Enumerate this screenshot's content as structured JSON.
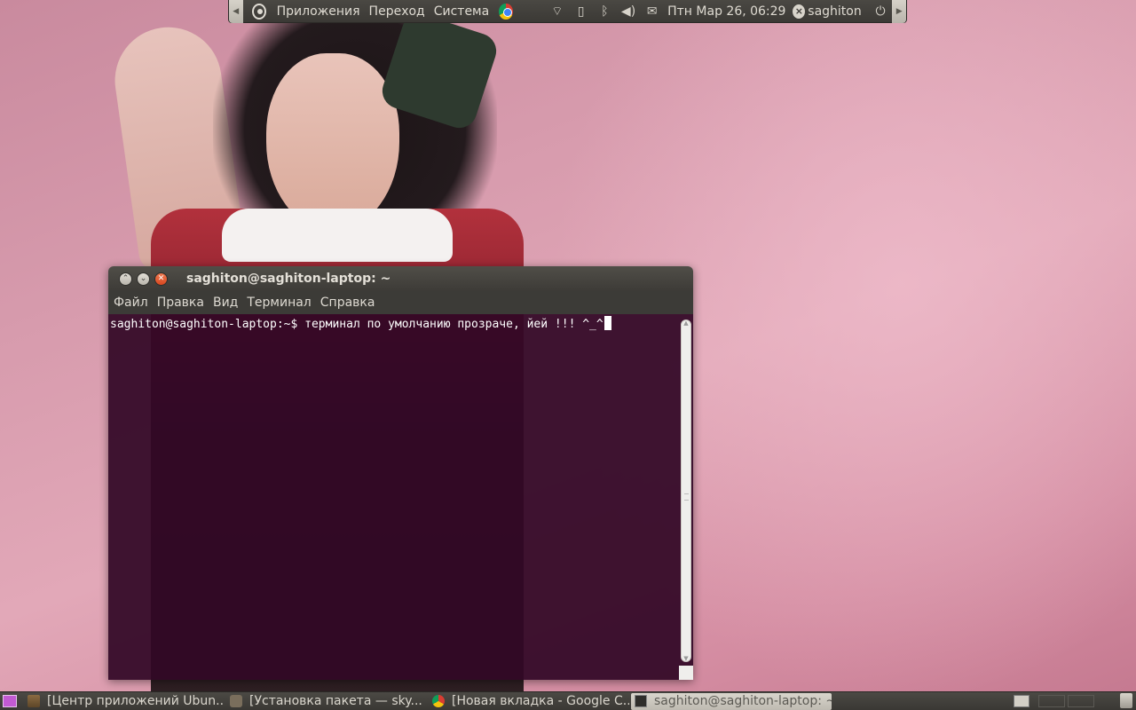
{
  "top_panel": {
    "menus": [
      "Приложения",
      "Переход",
      "Система"
    ],
    "tray_icons": [
      "wifi-icon",
      "battery-icon",
      "bluetooth-icon",
      "volume-icon",
      "mail-icon"
    ],
    "clock": "Птн Мар 26, 06:29",
    "user": "saghiton"
  },
  "terminal": {
    "title": "saghiton@saghiton-laptop: ~",
    "menu": [
      "Файл",
      "Правка",
      "Вид",
      "Терминал",
      "Справка"
    ],
    "prompt": "saghiton@saghiton-laptop:~$ ",
    "command": "терминал по умолчанию прозраче, йей !!! ^_^"
  },
  "taskbar": {
    "tasks": [
      {
        "label": "[Центр приложений Ubun...",
        "icon": "package-icon"
      },
      {
        "label": "[Установка пакета — sky...",
        "icon": "box-icon"
      },
      {
        "label": "[Новая вкладка - Google C...",
        "icon": "chrome-icon"
      },
      {
        "label": "saghiton@saghiton-laptop: ~",
        "icon": "terminal-icon",
        "active": true
      }
    ]
  },
  "colors": {
    "terminal_bg": "#300a24",
    "panel_bg": "#3c3b37",
    "close_button": "#df4a1f"
  }
}
